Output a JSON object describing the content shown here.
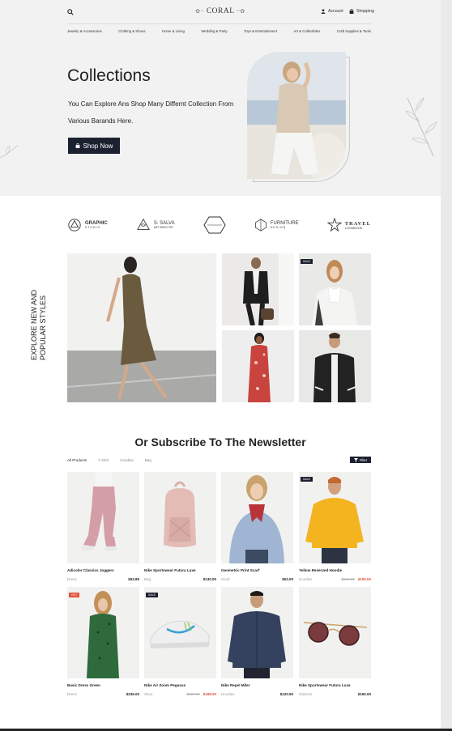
{
  "header": {
    "logo": "CORAL",
    "account": "Account",
    "shopping": "Shopping",
    "categories": [
      "Jewelry & Accessories",
      "Clothing & Shoes",
      "Home & Living",
      "Wedding & Party",
      "Toys & Entertainment",
      "Art & Collectibles",
      "Craft Supplies & Tools"
    ]
  },
  "hero": {
    "title": "Collections",
    "subtitle": "You Can Explore Ans Shop Many Differnt Collection From Various Barands Here.",
    "button": "Shop Now"
  },
  "brands": [
    {
      "name": "GRAPHIC",
      "sub": "STUDIO"
    },
    {
      "name": "S. SALVA",
      "sub": "ART DIRECTOR"
    },
    {
      "name": "",
      "sub": ""
    },
    {
      "name": "FURNITURE",
      "sub": "DESIGN"
    },
    {
      "name": "TRAVEL",
      "sub": "LOOKBOOK"
    }
  ],
  "explore": {
    "line1": "EXPLORE NEW AND",
    "line2": "POPULAR STYLES"
  },
  "gallery_badge": "SALE",
  "newsletter": {
    "title": "Or Subscribe To The Newsletter"
  },
  "filters": {
    "tabs": [
      "All Products",
      "T-Shirt",
      "Hoodies",
      "Bag"
    ],
    "button": "Filter"
  },
  "products": [
    {
      "name": "Adicolor Classics Joggers",
      "category": "Dress",
      "price": "$63.85",
      "old_price": "",
      "sale_price": "",
      "badge": ""
    },
    {
      "name": "Nike Sportswear Futura Luxe",
      "category": "Bag",
      "price": "$130.00",
      "old_price": "",
      "sale_price": "",
      "badge": ""
    },
    {
      "name": "Geometric Print Scarf",
      "category": "Scarf",
      "price": "$53.00",
      "old_price": "",
      "sale_price": "",
      "badge": ""
    },
    {
      "name": "Yellow Reserved Hoodie",
      "category": "Hoodies",
      "price": "",
      "old_price": "$364.00",
      "sale_price": "$155.00",
      "badge": "SALE"
    },
    {
      "name": "Basic Dress Green",
      "category": "Dress",
      "price": "$236.00",
      "old_price": "",
      "sale_price": "",
      "badge": "HOT"
    },
    {
      "name": "Nike Air Zoom Pegasus",
      "category": "Shoe",
      "price": "",
      "old_price": "$220.00",
      "sale_price": "$198.00",
      "badge": "SALE"
    },
    {
      "name": "Nike Repel Miler",
      "category": "Hoodies",
      "price": "$120.50",
      "old_price": "",
      "sale_price": "",
      "badge": ""
    },
    {
      "name": "Nike Sportswear Futura Luxe",
      "category": "Glasses",
      "price": "$160.00",
      "old_price": "",
      "sale_price": "",
      "badge": ""
    }
  ],
  "colors": {
    "dark": "#1c2130",
    "accent_sale": "#e0533d",
    "hero_bg": "#f1f2f1"
  }
}
